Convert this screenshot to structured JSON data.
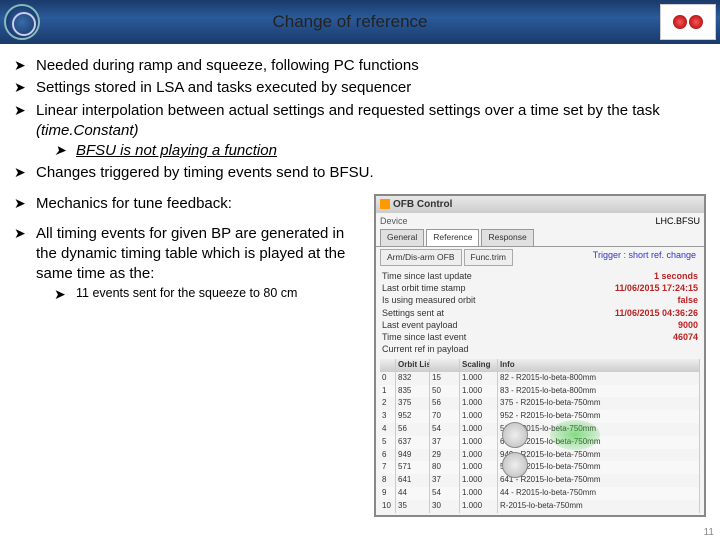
{
  "slide": {
    "title": "Change of reference",
    "bullets": [
      "Needed during ramp and squeeze, following PC functions",
      "Settings stored in LSA and tasks executed by sequencer",
      "Linear interpolation between actual settings and requested settings over a time set by the task",
      "BFSU is not playing a function",
      "Changes triggered by timing events send to BFSU.",
      "Mechanics for tune feedback:",
      "All timing events for given BP are generated in the dynamic timing table which is played at the same time as the:",
      "11 events sent for the squeeze to 80 cm"
    ],
    "timeConstant": "(time.Constant)"
  },
  "panel": {
    "title": "OFB Control",
    "deviceLabel": "Device",
    "deviceValue": "LHC.BFSU",
    "tabs": [
      "General",
      "Reference",
      "Response"
    ],
    "subtabs": [
      "Arm/Dis-arm OFB",
      "Func.trim"
    ],
    "triggerLabel": "Trigger : short ref. change",
    "kv": [
      {
        "k": "Time since last update",
        "v": "1 seconds"
      },
      {
        "k": "Last orbit time stamp",
        "v": "11/06/2015 17:24:15"
      },
      {
        "k": "Is using measured orbit",
        "v": "false"
      },
      {
        "k": "Settings sent at",
        "v": "11/06/2015 04:36:26"
      },
      {
        "k": "Last event payload",
        "v": "9000"
      },
      {
        "k": "Time since last event",
        "v": "46074"
      },
      {
        "k": "Current ref in payload",
        "v": ""
      }
    ],
    "headers": [
      "",
      "Orbit List",
      "",
      "Scaling",
      "Info"
    ],
    "rows": [
      {
        "n": "0",
        "h": "832",
        "v": "15",
        "s": "1.000",
        "i": "82 - R2015-lo-beta-800mm"
      },
      {
        "n": "1",
        "h": "835",
        "v": "50",
        "s": "1.000",
        "i": "83 - R2015-lo-beta-800mm"
      },
      {
        "n": "2",
        "h": "375",
        "v": "56",
        "s": "1.000",
        "i": "375 - R2015-lo-beta-750mm"
      },
      {
        "n": "3",
        "h": "952",
        "v": "70",
        "s": "1.000",
        "i": "952 - R2015-lo-beta-750mm"
      },
      {
        "n": "4",
        "h": "56",
        "v": "54",
        "s": "1.000",
        "i": "56 - R2015-lo-beta-750mm"
      },
      {
        "n": "5",
        "h": "637",
        "v": "37",
        "s": "1.000",
        "i": "637 - R2015-lo-beta-750mm"
      },
      {
        "n": "6",
        "h": "949",
        "v": "29",
        "s": "1.000",
        "i": "949 - R2015-lo-beta-750mm"
      },
      {
        "n": "7",
        "h": "571",
        "v": "80",
        "s": "1.000",
        "i": "571 - R2015-lo-beta-750mm"
      },
      {
        "n": "8",
        "h": "641",
        "v": "37",
        "s": "1.000",
        "i": "641 - R2015-lo-beta-750mm"
      },
      {
        "n": "9",
        "h": "44",
        "v": "54",
        "s": "1.000",
        "i": "44 - R2015-lo-beta-750mm"
      },
      {
        "n": "10",
        "h": "35",
        "v": "30",
        "s": "1.000",
        "i": "R-2015-lo-beta-750mm"
      }
    ]
  },
  "pagenum": "11"
}
